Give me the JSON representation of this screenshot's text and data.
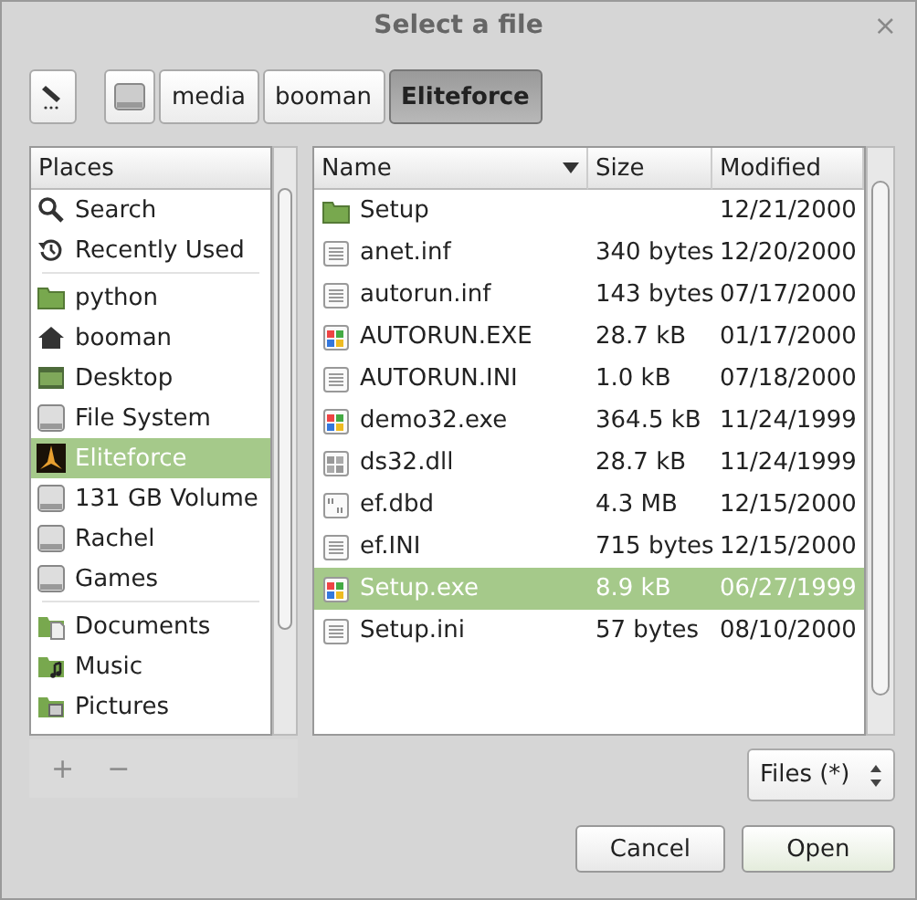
{
  "window": {
    "title": "Select a file",
    "close": "×"
  },
  "path_bar": {
    "segments": [
      {
        "kind": "drive",
        "selected": false
      },
      {
        "kind": "text",
        "label": "media",
        "selected": false
      },
      {
        "kind": "text",
        "label": "booman",
        "selected": false
      },
      {
        "kind": "text",
        "label": "Eliteforce",
        "selected": true
      }
    ]
  },
  "places": {
    "header": "Places",
    "groups": [
      [
        {
          "kind": "search",
          "label": "Search",
          "selected": false
        },
        {
          "kind": "recent",
          "label": "Recently Used",
          "selected": false
        }
      ],
      [
        {
          "kind": "folder",
          "label": "python",
          "selected": false
        },
        {
          "kind": "home",
          "label": "booman",
          "selected": false
        },
        {
          "kind": "desktop",
          "label": "Desktop",
          "selected": false
        },
        {
          "kind": "drive",
          "label": "File System",
          "selected": false
        },
        {
          "kind": "app",
          "label": "Eliteforce",
          "selected": true
        },
        {
          "kind": "drive",
          "label": "131 GB Volume",
          "selected": false
        },
        {
          "kind": "drive",
          "label": "Rachel",
          "selected": false
        },
        {
          "kind": "drive",
          "label": "Games",
          "selected": false
        }
      ],
      [
        {
          "kind": "documents",
          "label": "Documents",
          "selected": false
        },
        {
          "kind": "music",
          "label": "Music",
          "selected": false
        },
        {
          "kind": "pictures",
          "label": "Pictures",
          "selected": false
        }
      ]
    ],
    "add": "+",
    "remove": "−"
  },
  "files": {
    "columns": [
      "Name",
      "Size",
      "Modified"
    ],
    "rows": [
      {
        "kind": "folder",
        "name": "Setup",
        "size": "",
        "modified": "12/21/2000",
        "selected": false
      },
      {
        "kind": "text",
        "name": "anet.inf",
        "size": "340 bytes",
        "modified": "12/20/2000",
        "selected": false
      },
      {
        "kind": "text",
        "name": "autorun.inf",
        "size": "143 bytes",
        "modified": "07/17/2000",
        "selected": false
      },
      {
        "kind": "exe",
        "name": "AUTORUN.EXE",
        "size": "28.7 kB",
        "modified": "01/17/2000",
        "selected": false
      },
      {
        "kind": "text",
        "name": "AUTORUN.INI",
        "size": "1.0 kB",
        "modified": "07/18/2000",
        "selected": false
      },
      {
        "kind": "exe",
        "name": "demo32.exe",
        "size": "364.5 kB",
        "modified": "11/24/1999",
        "selected": false
      },
      {
        "kind": "dll",
        "name": "ds32.dll",
        "size": "28.7 kB",
        "modified": "11/24/1999",
        "selected": false
      },
      {
        "kind": "binary",
        "name": "ef.dbd",
        "size": "4.3 MB",
        "modified": "12/15/2000",
        "selected": false
      },
      {
        "kind": "text",
        "name": "ef.INI",
        "size": "715 bytes",
        "modified": "12/15/2000",
        "selected": false
      },
      {
        "kind": "exe",
        "name": "Setup.exe",
        "size": "8.9 kB",
        "modified": "06/27/1999",
        "selected": true
      },
      {
        "kind": "text",
        "name": "Setup.ini",
        "size": "57 bytes",
        "modified": "08/10/2000",
        "selected": false
      }
    ]
  },
  "filter": {
    "value": "Files (*)"
  },
  "buttons": [
    {
      "label": "Cancel"
    },
    {
      "label": "Open"
    }
  ]
}
